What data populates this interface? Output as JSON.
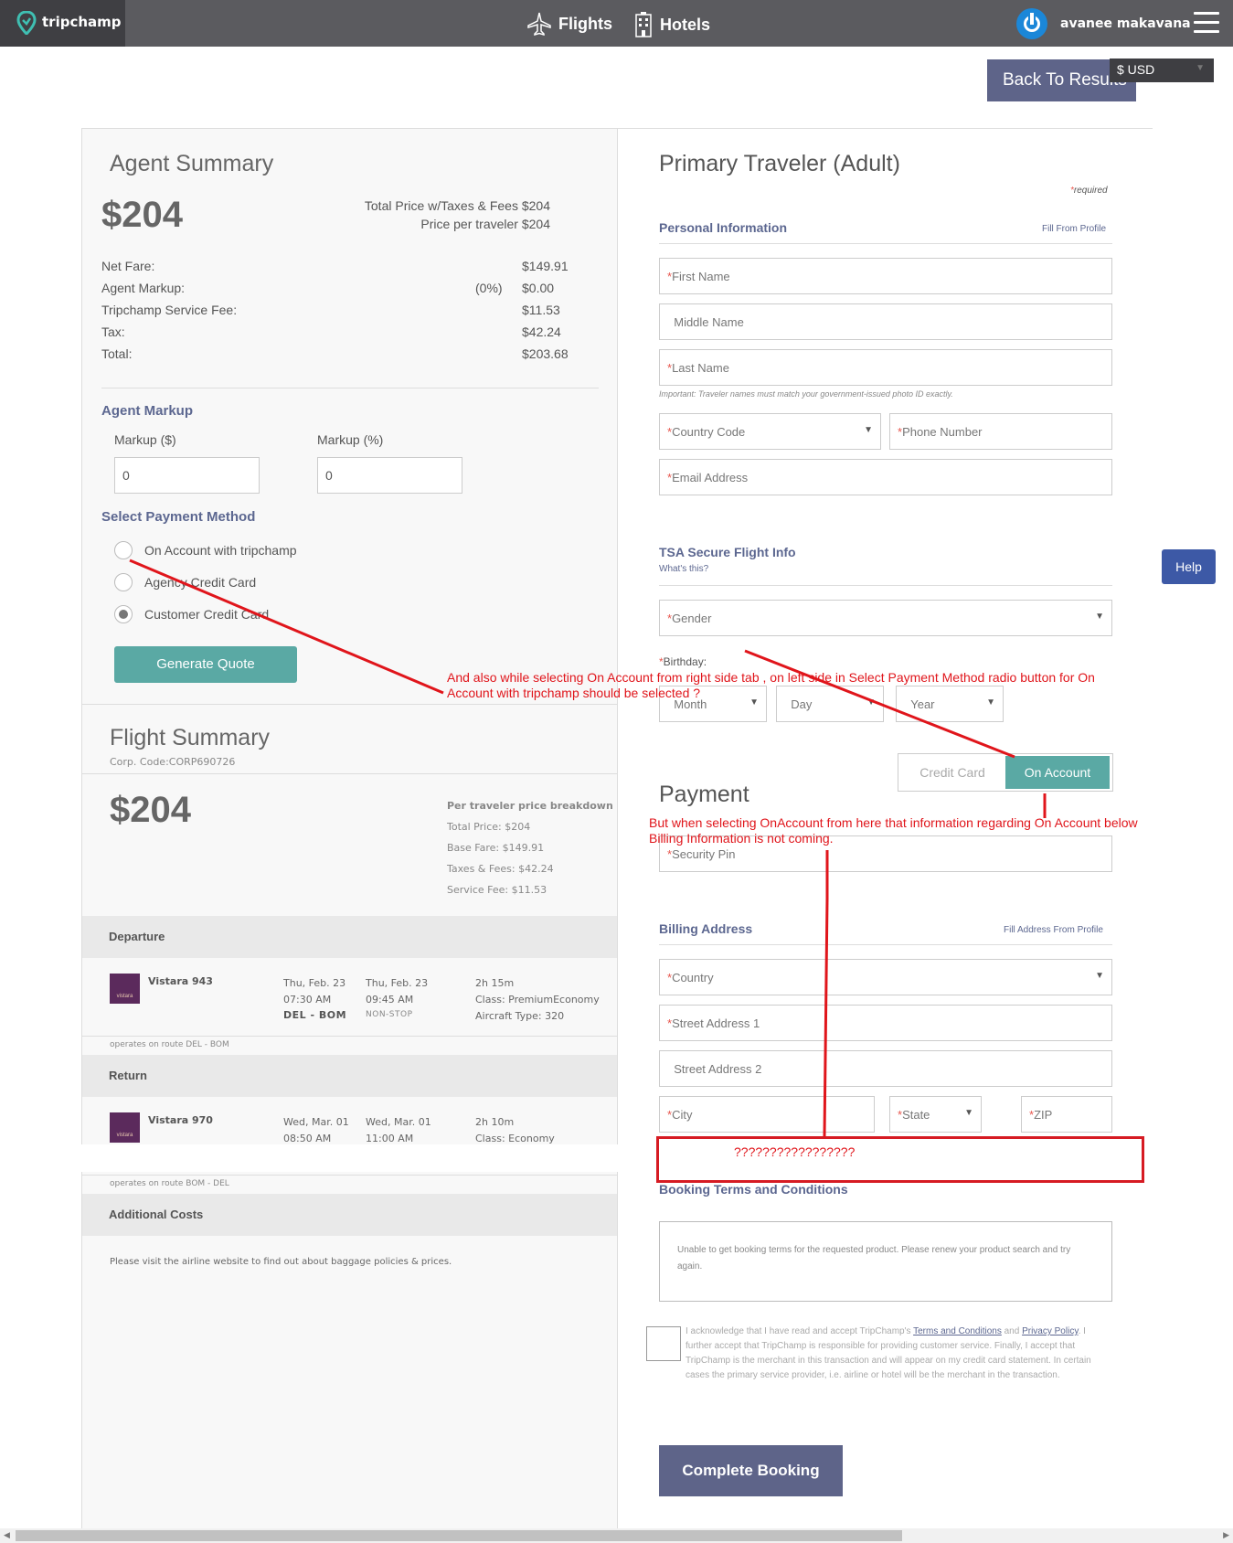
{
  "topbar": {
    "brand": "tripchamp",
    "nav": [
      {
        "label": "Flights",
        "icon": "airplane-icon"
      },
      {
        "label": "Hotels",
        "icon": "hotel-icon"
      }
    ],
    "user_name": "avanee makavana"
  },
  "back_to_results": "Back To Results",
  "currency": "$ USD",
  "help": "Help",
  "agent_summary": {
    "title": "Agent Summary",
    "price": "$204",
    "total_line": "Total Price w/Taxes & Fees $204",
    "per_traveler_line": "Price per traveler $204",
    "rows": [
      {
        "label": "Net Fare:",
        "pct": "",
        "value": "$149.91"
      },
      {
        "label": "Agent Markup:",
        "pct": "(0%)",
        "value": "$0.00"
      },
      {
        "label": "Tripchamp Service Fee:",
        "pct": "",
        "value": "$11.53"
      },
      {
        "label": "Tax:",
        "pct": "",
        "value": "$42.24"
      },
      {
        "label": "Total:",
        "pct": "",
        "value": "$203.68"
      }
    ],
    "markup_title": "Agent Markup",
    "markup_usd_label": "Markup ($)",
    "markup_usd_value": "0",
    "markup_pct_label": "Markup (%)",
    "markup_pct_value": "0",
    "payment_title": "Select Payment Method",
    "payment_options": [
      "On Account with tripchamp",
      "Agency Credit Card",
      "Customer Credit Card"
    ],
    "selected_payment": "Customer Credit Card",
    "generate_quote": "Generate Quote"
  },
  "flight_summary": {
    "title": "Flight Summary",
    "corp_code": "Corp. Code:CORP690726",
    "price": "$204",
    "breakdown_title": "Per traveler price breakdown",
    "breakdown": [
      "Total Price: $204",
      "Base Fare: $149.91",
      "Taxes & Fees: $42.24",
      "Service Fee: $11.53"
    ],
    "departure": {
      "band": "Departure",
      "airline": "Vistara 943",
      "logo_text": "vistara",
      "dep_date": "Thu, Feb. 23",
      "dep_time": "07:30 AM",
      "route": "DEL - BOM",
      "arr_date": "Thu, Feb. 23",
      "arr_time": "09:45 AM",
      "stops": "NON-STOP",
      "duration": "2h 15m",
      "class": "Class: PremiumEconomy",
      "aircraft": "Aircraft Type: 320",
      "operates": "operates on route DEL - BOM"
    },
    "return": {
      "band": "Return",
      "airline": "Vistara 970",
      "logo_text": "vistara",
      "dep_date": "Wed, Mar. 01",
      "dep_time": "08:50 AM",
      "arr_date": "Wed, Mar. 01",
      "arr_time": "11:00 AM",
      "duration": "2h 10m",
      "class": "Class: Economy",
      "operates": "operates on route BOM - DEL"
    },
    "additional_band": "Additional Costs",
    "additional_text": "Please visit the airline website to find out about baggage policies & prices."
  },
  "traveler": {
    "title": "Primary Traveler (Adult)",
    "required": "required",
    "personal_title": "Personal Information",
    "fill_profile": "Fill From Profile",
    "first_name": "First Name",
    "middle_name": "Middle Name",
    "last_name": "Last Name",
    "name_note": "Important: Traveler names must match your government-issued photo ID exactly.",
    "country_code": "Country Code",
    "phone": "Phone Number",
    "email": "Email Address",
    "tsa_title": "TSA Secure Flight Info",
    "tsa_link": "What's this?",
    "gender": "Gender",
    "birthday_label": "Birthday:",
    "month": "Month",
    "day": "Day",
    "year": "Year"
  },
  "payment": {
    "title": "Payment",
    "tab_credit": "Credit Card",
    "tab_account": "On Account",
    "security_pin": "Security Pin"
  },
  "billing": {
    "title": "Billing Address",
    "fill_link": "Fill Address From Profile",
    "country": "Country",
    "street1": "Street Address 1",
    "street2": "Street Address 2",
    "city": "City",
    "state": "State",
    "zip": "ZIP"
  },
  "terms": {
    "title": "Booking Terms and Conditions",
    "box_text": "Unable to get booking terms for the requested product. Please renew your product search and try again.",
    "ack_1": "I acknowledge that I have read and accept TripChamp's ",
    "terms_link": "Terms and Conditions",
    "ack_and": " and ",
    "privacy_link": "Privacy Policy",
    "ack_2": ". I further accept that TripChamp is responsible for providing customer service. Finally, I accept that TripChamp is the merchant in this transaction and will appear on my credit card statement. In certain cases the primary service provider, i.e. airline or hotel will be the merchant in the transaction."
  },
  "complete_booking": "Complete Booking",
  "annotations": {
    "note1": "And also while selecting On Account from right side tab , on left side in Select Payment Method radio button for On Account with tripchamp should be selected ?",
    "note2": "But when selecting OnAccount from here that information regarding On Account below Billing Information is not coming.",
    "question": "?????????????????"
  },
  "colors": {
    "accent_teal": "#5aa9a4",
    "primary_button": "#5e6489",
    "annotation_red": "#e0151b"
  }
}
